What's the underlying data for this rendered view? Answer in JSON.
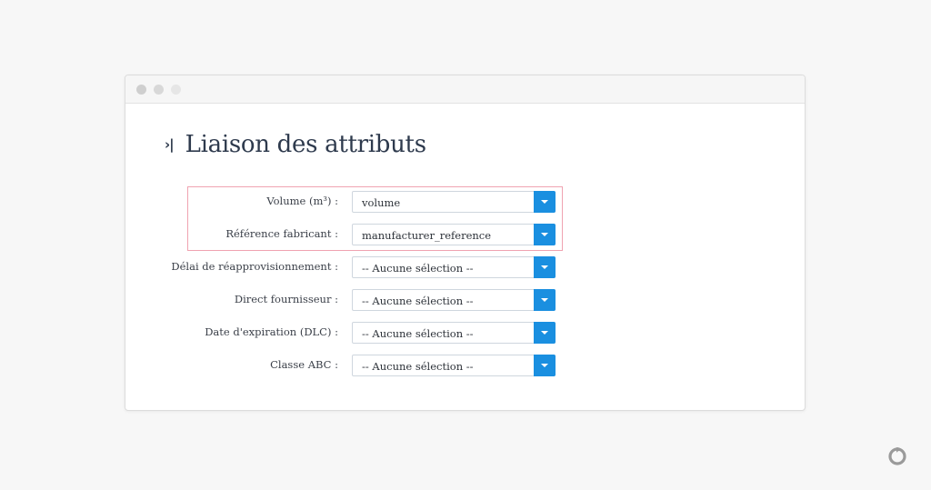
{
  "page": {
    "title": "Liaison des attributs",
    "title_icon": "chevron-right-bar-icon"
  },
  "fields": [
    {
      "label": "Volume (m³) :",
      "value": "volume",
      "highlighted": true
    },
    {
      "label": "Référence fabricant :",
      "value": "manufacturer_reference",
      "highlighted": true
    },
    {
      "label": "Délai de réapprovisionnement :",
      "value": "-- Aucune sélection --",
      "highlighted": false
    },
    {
      "label": "Direct fournisseur :",
      "value": "-- Aucune sélection --",
      "highlighted": false
    },
    {
      "label": "Date d'expiration (DLC) :",
      "value": "-- Aucune sélection --",
      "highlighted": false
    },
    {
      "label": "Classe ABC :",
      "value": "-- Aucune sélection --",
      "highlighted": false
    }
  ],
  "colors": {
    "accent": "#1a8fe0",
    "highlight_border": "#f0a3b1",
    "title": "#2e3a4d"
  },
  "icons": {
    "dropdown": "caret-down-icon",
    "brand": "brand-logo-icon"
  }
}
